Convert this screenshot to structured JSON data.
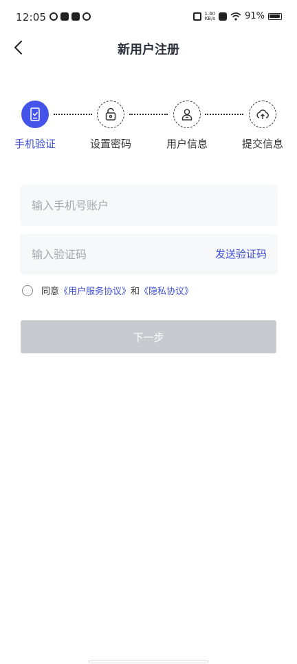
{
  "status_bar": {
    "time": "12:05",
    "net_speed_top": "1.40",
    "net_speed_bottom": "KB/s",
    "battery": "91%"
  },
  "header": {
    "title": "新用户注册",
    "back_icon": "chevron-left-icon"
  },
  "steps": [
    {
      "label": "手机验证",
      "icon": "phone-check-icon",
      "active": true
    },
    {
      "label": "设置密码",
      "icon": "lock-icon",
      "active": false
    },
    {
      "label": "用户信息",
      "icon": "user-icon",
      "active": false
    },
    {
      "label": "提交信息",
      "icon": "cloud-upload-icon",
      "active": false
    }
  ],
  "form": {
    "phone_placeholder": "输入手机号账户",
    "phone_value": "",
    "code_placeholder": "输入验证码",
    "code_value": "",
    "send_code_label": "发送验证码",
    "agree_prefix": "同意",
    "agree_link1": "《用户服务协议》",
    "agree_and": "和",
    "agree_link2": "《隐私协议》",
    "next_label": "下一步"
  },
  "colors": {
    "accent": "#4453e8",
    "disabled_button": "#c8cad0",
    "field_bg": "#f7f8fa"
  }
}
